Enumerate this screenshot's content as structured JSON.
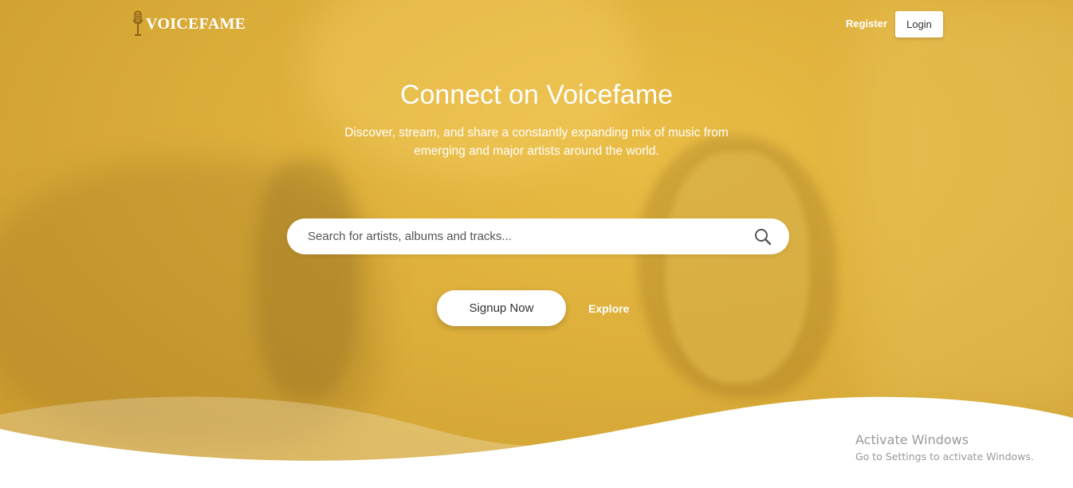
{
  "brand": {
    "name": "VOICEFAME"
  },
  "nav": {
    "register_label": "Register",
    "login_label": "Login"
  },
  "hero": {
    "headline": "Connect on Voicefame",
    "subtitle": "Discover, stream, and share a constantly expanding mix of music from emerging and major artists around the world.",
    "overlay_color": "#dcae3a"
  },
  "search": {
    "placeholder": "Search for artists, albums and tracks...",
    "value": "",
    "icon": "search-icon"
  },
  "actions": {
    "signup_label": "Signup Now",
    "explore_label": "Explore"
  },
  "os_watermark": {
    "title": "Activate Windows",
    "subtitle": "Go to Settings to activate Windows."
  }
}
